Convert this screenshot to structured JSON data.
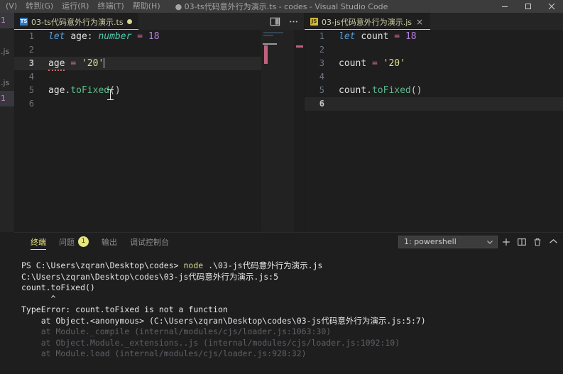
{
  "titlebar": {
    "menu_items": [
      "(V)",
      "转到(G)",
      "运行(R)",
      "终端(T)",
      "帮助(H)"
    ],
    "title": "● 03-ts代码意外行为演示.ts - codes - Visual Studio Code",
    "window_controls": [
      "minimize",
      "maximize",
      "close"
    ]
  },
  "sidebar": {
    "rows": [
      "1",
      "",
      ".js",
      "",
      ".js",
      "1"
    ]
  },
  "editor_left": {
    "tab": {
      "label": "03-ts代码意外行为演示.ts",
      "icon": "TS",
      "dirty": true
    },
    "actions": [
      "split-editor-icon",
      "more-actions-icon"
    ],
    "lines": [
      {
        "n": "1",
        "current": false,
        "tokens": [
          {
            "t": "let",
            "c": "kw-italic"
          },
          {
            "t": " ",
            "c": "plain"
          },
          {
            "t": "age",
            "c": "var"
          },
          {
            "t": ":",
            "c": "colon"
          },
          {
            "t": " ",
            "c": "plain"
          },
          {
            "t": "number",
            "c": "type"
          },
          {
            "t": " ",
            "c": "plain"
          },
          {
            "t": "=",
            "c": "op"
          },
          {
            "t": " ",
            "c": "plain"
          },
          {
            "t": "18",
            "c": "num-purple"
          }
        ]
      },
      {
        "n": "2",
        "current": false,
        "tokens": []
      },
      {
        "n": "3",
        "current": true,
        "tokens": [
          {
            "t": "age",
            "c": "var squiggle"
          },
          {
            "t": " ",
            "c": "plain"
          },
          {
            "t": "=",
            "c": "op"
          },
          {
            "t": " ",
            "c": "plain"
          },
          {
            "t": "'20'",
            "c": "str"
          }
        ]
      },
      {
        "n": "4",
        "current": false,
        "tokens": []
      },
      {
        "n": "5",
        "current": false,
        "tokens": [
          {
            "t": "age",
            "c": "var"
          },
          {
            "t": ".",
            "c": "punct"
          },
          {
            "t": "toFixed",
            "c": "fn"
          },
          {
            "t": "()",
            "c": "punct"
          }
        ]
      },
      {
        "n": "6",
        "current": false,
        "tokens": []
      }
    ]
  },
  "editor_right": {
    "tab": {
      "label": "03-js代码意外行为演示.js",
      "icon": "JS",
      "dirty": false,
      "close": "×"
    },
    "lines": [
      {
        "n": "1",
        "current": false,
        "tokens": [
          {
            "t": "let",
            "c": "kw-italic"
          },
          {
            "t": " ",
            "c": "plain"
          },
          {
            "t": "count",
            "c": "var"
          },
          {
            "t": " ",
            "c": "plain"
          },
          {
            "t": "=",
            "c": "op"
          },
          {
            "t": " ",
            "c": "plain"
          },
          {
            "t": "18",
            "c": "num-purple"
          }
        ]
      },
      {
        "n": "2",
        "current": false,
        "tokens": []
      },
      {
        "n": "3",
        "current": false,
        "tokens": [
          {
            "t": "count",
            "c": "var"
          },
          {
            "t": " ",
            "c": "plain"
          },
          {
            "t": "=",
            "c": "op"
          },
          {
            "t": " ",
            "c": "plain"
          },
          {
            "t": "'20'",
            "c": "str"
          }
        ]
      },
      {
        "n": "4",
        "current": false,
        "tokens": []
      },
      {
        "n": "5",
        "current": false,
        "tokens": [
          {
            "t": "count",
            "c": "var"
          },
          {
            "t": ".",
            "c": "punct"
          },
          {
            "t": "toFixed",
            "c": "fn"
          },
          {
            "t": "()",
            "c": "punct"
          }
        ]
      },
      {
        "n": "6",
        "current": true,
        "tokens": []
      }
    ]
  },
  "panel": {
    "tabs": [
      {
        "label": "终端",
        "active": true,
        "badge": null
      },
      {
        "label": "问题",
        "active": false,
        "badge": "1"
      },
      {
        "label": "输出",
        "active": false,
        "badge": null
      },
      {
        "label": "调试控制台",
        "active": false,
        "badge": null
      }
    ],
    "terminal_select": "1: powershell",
    "actions": [
      "new-terminal-icon",
      "split-terminal-icon",
      "kill-terminal-icon",
      "hide-panel-icon"
    ],
    "terminal_lines": [
      [
        {
          "t": "PS C:\\Users\\zqran\\Desktop\\codes> ",
          "c": "t-white"
        },
        {
          "t": "node",
          "c": "t-yellow"
        },
        {
          "t": " .\\03-js代码意外行为演示.js",
          "c": "t-white"
        }
      ],
      [
        {
          "t": "C:\\Users\\zqran\\Desktop\\codes\\03-js代码意外行为演示.js:5",
          "c": "t-white"
        }
      ],
      [
        {
          "t": "count.toFixed()",
          "c": "t-white"
        }
      ],
      [
        {
          "t": "      ^",
          "c": "t-white"
        }
      ],
      [
        {
          "t": "",
          "c": "t-white"
        }
      ],
      [
        {
          "t": "TypeError: count.toFixed is not a function",
          "c": "t-err"
        }
      ],
      [
        {
          "t": "    at Object.<anonymous> (C:\\Users\\zqran\\Desktop\\codes\\03-js代码意外行为演示.js:5:7)",
          "c": "t-white"
        }
      ],
      [
        {
          "t": "    at Module._compile (internal/modules/cjs/loader.js:1063:30)",
          "c": "t-dim"
        }
      ],
      [
        {
          "t": "    at Object.Module._extensions..js (internal/modules/cjs/loader.js:1092:10)",
          "c": "t-dim"
        }
      ],
      [
        {
          "t": "    at Module.load (internal/modules/cjs/loader.js:928:32)",
          "c": "t-dim"
        }
      ]
    ]
  }
}
